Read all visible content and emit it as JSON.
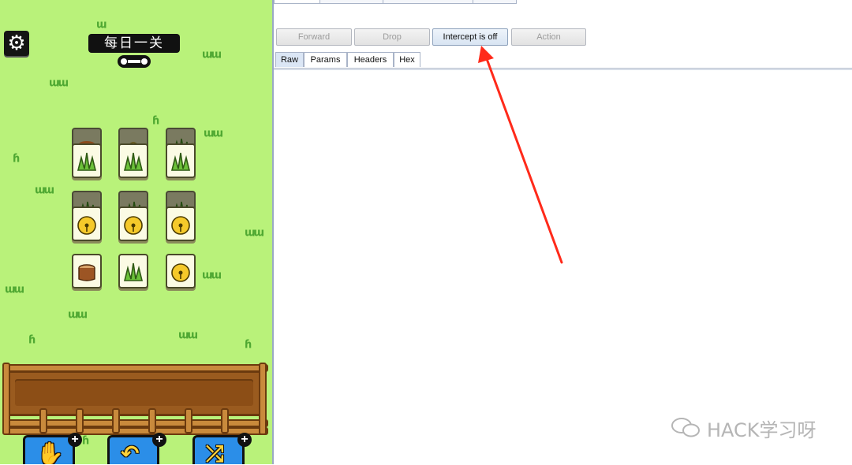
{
  "game": {
    "level_title": "每日一关",
    "settings_icon": "gear-icon",
    "tiles": [
      {
        "row": 1,
        "col": 1,
        "item": "grass",
        "layer": "top",
        "under": "stump"
      },
      {
        "row": 1,
        "col": 2,
        "item": "grass",
        "layer": "top",
        "under": "haystack"
      },
      {
        "row": 1,
        "col": 3,
        "item": "grass",
        "layer": "top",
        "under": "grass"
      },
      {
        "row": 2,
        "col": 1,
        "item": "bell",
        "layer": "top",
        "under": "grass"
      },
      {
        "row": 2,
        "col": 2,
        "item": "bell",
        "layer": "top",
        "under": "grass"
      },
      {
        "row": 2,
        "col": 3,
        "item": "bell",
        "layer": "top",
        "under": "grass"
      },
      {
        "row": 3,
        "col": 1,
        "item": "stump",
        "layer": "top"
      },
      {
        "row": 3,
        "col": 2,
        "item": "grass",
        "layer": "top"
      },
      {
        "row": 3,
        "col": 3,
        "item": "bell",
        "layer": "top"
      }
    ],
    "powerups": [
      {
        "name": "move-out",
        "icon": "hand-icon",
        "plus": "+"
      },
      {
        "name": "undo",
        "icon": "undo-icon",
        "plus": "+"
      },
      {
        "name": "shuffle",
        "icon": "shuffle-icon",
        "plus": "+"
      }
    ]
  },
  "burp": {
    "toolbar": {
      "forward_label": "Forward",
      "drop_label": "Drop",
      "intercept_label": "Intercept is off",
      "action_label": "Action"
    },
    "message_tabs": [
      "Raw",
      "Params",
      "Headers",
      "Hex"
    ],
    "selected_tab": "Raw"
  },
  "annotation": {
    "arrow_color": "#ff2a1a"
  },
  "watermark": {
    "text": "HACK学习呀"
  }
}
